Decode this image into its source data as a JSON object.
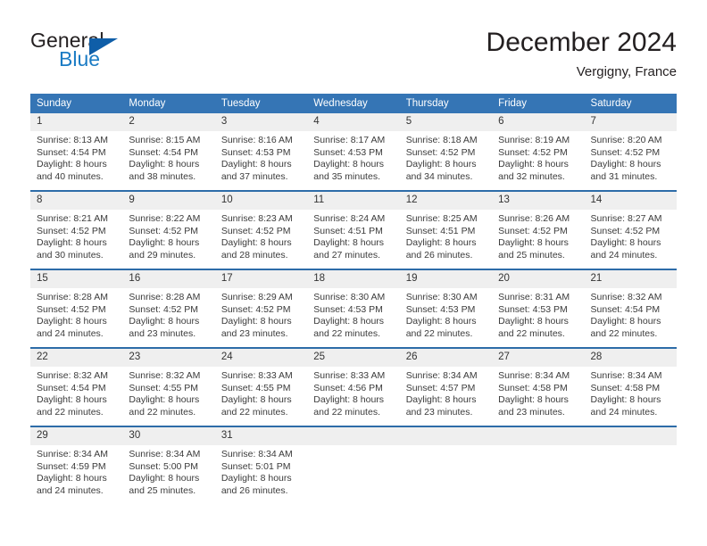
{
  "logo": {
    "word_top": "General",
    "word_bottom": "Blue",
    "triangle_color": "#0f5ea8",
    "blue_color": "#1a7bc4"
  },
  "header": {
    "title": "December 2024",
    "subtitle": "Vergigny, France"
  },
  "theme": {
    "header_bg": "#3575b5",
    "row_divider": "#2d6ca8",
    "daynum_bg": "#efefef"
  },
  "calendar": {
    "weekday_headers": [
      "Sunday",
      "Monday",
      "Tuesday",
      "Wednesday",
      "Thursday",
      "Friday",
      "Saturday"
    ],
    "labels": {
      "sunrise": "Sunrise:",
      "sunset": "Sunset:",
      "daylight": "Daylight:"
    },
    "weeks": [
      [
        {
          "day": "1",
          "sunrise": "Sunrise: 8:13 AM",
          "sunset": "Sunset: 4:54 PM",
          "daylight1": "Daylight: 8 hours",
          "daylight2": "and 40 minutes."
        },
        {
          "day": "2",
          "sunrise": "Sunrise: 8:15 AM",
          "sunset": "Sunset: 4:54 PM",
          "daylight1": "Daylight: 8 hours",
          "daylight2": "and 38 minutes."
        },
        {
          "day": "3",
          "sunrise": "Sunrise: 8:16 AM",
          "sunset": "Sunset: 4:53 PM",
          "daylight1": "Daylight: 8 hours",
          "daylight2": "and 37 minutes."
        },
        {
          "day": "4",
          "sunrise": "Sunrise: 8:17 AM",
          "sunset": "Sunset: 4:53 PM",
          "daylight1": "Daylight: 8 hours",
          "daylight2": "and 35 minutes."
        },
        {
          "day": "5",
          "sunrise": "Sunrise: 8:18 AM",
          "sunset": "Sunset: 4:52 PM",
          "daylight1": "Daylight: 8 hours",
          "daylight2": "and 34 minutes."
        },
        {
          "day": "6",
          "sunrise": "Sunrise: 8:19 AM",
          "sunset": "Sunset: 4:52 PM",
          "daylight1": "Daylight: 8 hours",
          "daylight2": "and 32 minutes."
        },
        {
          "day": "7",
          "sunrise": "Sunrise: 8:20 AM",
          "sunset": "Sunset: 4:52 PM",
          "daylight1": "Daylight: 8 hours",
          "daylight2": "and 31 minutes."
        }
      ],
      [
        {
          "day": "8",
          "sunrise": "Sunrise: 8:21 AM",
          "sunset": "Sunset: 4:52 PM",
          "daylight1": "Daylight: 8 hours",
          "daylight2": "and 30 minutes."
        },
        {
          "day": "9",
          "sunrise": "Sunrise: 8:22 AM",
          "sunset": "Sunset: 4:52 PM",
          "daylight1": "Daylight: 8 hours",
          "daylight2": "and 29 minutes."
        },
        {
          "day": "10",
          "sunrise": "Sunrise: 8:23 AM",
          "sunset": "Sunset: 4:52 PM",
          "daylight1": "Daylight: 8 hours",
          "daylight2": "and 28 minutes."
        },
        {
          "day": "11",
          "sunrise": "Sunrise: 8:24 AM",
          "sunset": "Sunset: 4:51 PM",
          "daylight1": "Daylight: 8 hours",
          "daylight2": "and 27 minutes."
        },
        {
          "day": "12",
          "sunrise": "Sunrise: 8:25 AM",
          "sunset": "Sunset: 4:51 PM",
          "daylight1": "Daylight: 8 hours",
          "daylight2": "and 26 minutes."
        },
        {
          "day": "13",
          "sunrise": "Sunrise: 8:26 AM",
          "sunset": "Sunset: 4:52 PM",
          "daylight1": "Daylight: 8 hours",
          "daylight2": "and 25 minutes."
        },
        {
          "day": "14",
          "sunrise": "Sunrise: 8:27 AM",
          "sunset": "Sunset: 4:52 PM",
          "daylight1": "Daylight: 8 hours",
          "daylight2": "and 24 minutes."
        }
      ],
      [
        {
          "day": "15",
          "sunrise": "Sunrise: 8:28 AM",
          "sunset": "Sunset: 4:52 PM",
          "daylight1": "Daylight: 8 hours",
          "daylight2": "and 24 minutes."
        },
        {
          "day": "16",
          "sunrise": "Sunrise: 8:28 AM",
          "sunset": "Sunset: 4:52 PM",
          "daylight1": "Daylight: 8 hours",
          "daylight2": "and 23 minutes."
        },
        {
          "day": "17",
          "sunrise": "Sunrise: 8:29 AM",
          "sunset": "Sunset: 4:52 PM",
          "daylight1": "Daylight: 8 hours",
          "daylight2": "and 23 minutes."
        },
        {
          "day": "18",
          "sunrise": "Sunrise: 8:30 AM",
          "sunset": "Sunset: 4:53 PM",
          "daylight1": "Daylight: 8 hours",
          "daylight2": "and 22 minutes."
        },
        {
          "day": "19",
          "sunrise": "Sunrise: 8:30 AM",
          "sunset": "Sunset: 4:53 PM",
          "daylight1": "Daylight: 8 hours",
          "daylight2": "and 22 minutes."
        },
        {
          "day": "20",
          "sunrise": "Sunrise: 8:31 AM",
          "sunset": "Sunset: 4:53 PM",
          "daylight1": "Daylight: 8 hours",
          "daylight2": "and 22 minutes."
        },
        {
          "day": "21",
          "sunrise": "Sunrise: 8:32 AM",
          "sunset": "Sunset: 4:54 PM",
          "daylight1": "Daylight: 8 hours",
          "daylight2": "and 22 minutes."
        }
      ],
      [
        {
          "day": "22",
          "sunrise": "Sunrise: 8:32 AM",
          "sunset": "Sunset: 4:54 PM",
          "daylight1": "Daylight: 8 hours",
          "daylight2": "and 22 minutes."
        },
        {
          "day": "23",
          "sunrise": "Sunrise: 8:32 AM",
          "sunset": "Sunset: 4:55 PM",
          "daylight1": "Daylight: 8 hours",
          "daylight2": "and 22 minutes."
        },
        {
          "day": "24",
          "sunrise": "Sunrise: 8:33 AM",
          "sunset": "Sunset: 4:55 PM",
          "daylight1": "Daylight: 8 hours",
          "daylight2": "and 22 minutes."
        },
        {
          "day": "25",
          "sunrise": "Sunrise: 8:33 AM",
          "sunset": "Sunset: 4:56 PM",
          "daylight1": "Daylight: 8 hours",
          "daylight2": "and 22 minutes."
        },
        {
          "day": "26",
          "sunrise": "Sunrise: 8:34 AM",
          "sunset": "Sunset: 4:57 PM",
          "daylight1": "Daylight: 8 hours",
          "daylight2": "and 23 minutes."
        },
        {
          "day": "27",
          "sunrise": "Sunrise: 8:34 AM",
          "sunset": "Sunset: 4:58 PM",
          "daylight1": "Daylight: 8 hours",
          "daylight2": "and 23 minutes."
        },
        {
          "day": "28",
          "sunrise": "Sunrise: 8:34 AM",
          "sunset": "Sunset: 4:58 PM",
          "daylight1": "Daylight: 8 hours",
          "daylight2": "and 24 minutes."
        }
      ],
      [
        {
          "day": "29",
          "sunrise": "Sunrise: 8:34 AM",
          "sunset": "Sunset: 4:59 PM",
          "daylight1": "Daylight: 8 hours",
          "daylight2": "and 24 minutes."
        },
        {
          "day": "30",
          "sunrise": "Sunrise: 8:34 AM",
          "sunset": "Sunset: 5:00 PM",
          "daylight1": "Daylight: 8 hours",
          "daylight2": "and 25 minutes."
        },
        {
          "day": "31",
          "sunrise": "Sunrise: 8:34 AM",
          "sunset": "Sunset: 5:01 PM",
          "daylight1": "Daylight: 8 hours",
          "daylight2": "and 26 minutes."
        },
        {
          "day": "",
          "sunrise": "",
          "sunset": "",
          "daylight1": "",
          "daylight2": ""
        },
        {
          "day": "",
          "sunrise": "",
          "sunset": "",
          "daylight1": "",
          "daylight2": ""
        },
        {
          "day": "",
          "sunrise": "",
          "sunset": "",
          "daylight1": "",
          "daylight2": ""
        },
        {
          "day": "",
          "sunrise": "",
          "sunset": "",
          "daylight1": "",
          "daylight2": ""
        }
      ]
    ]
  }
}
